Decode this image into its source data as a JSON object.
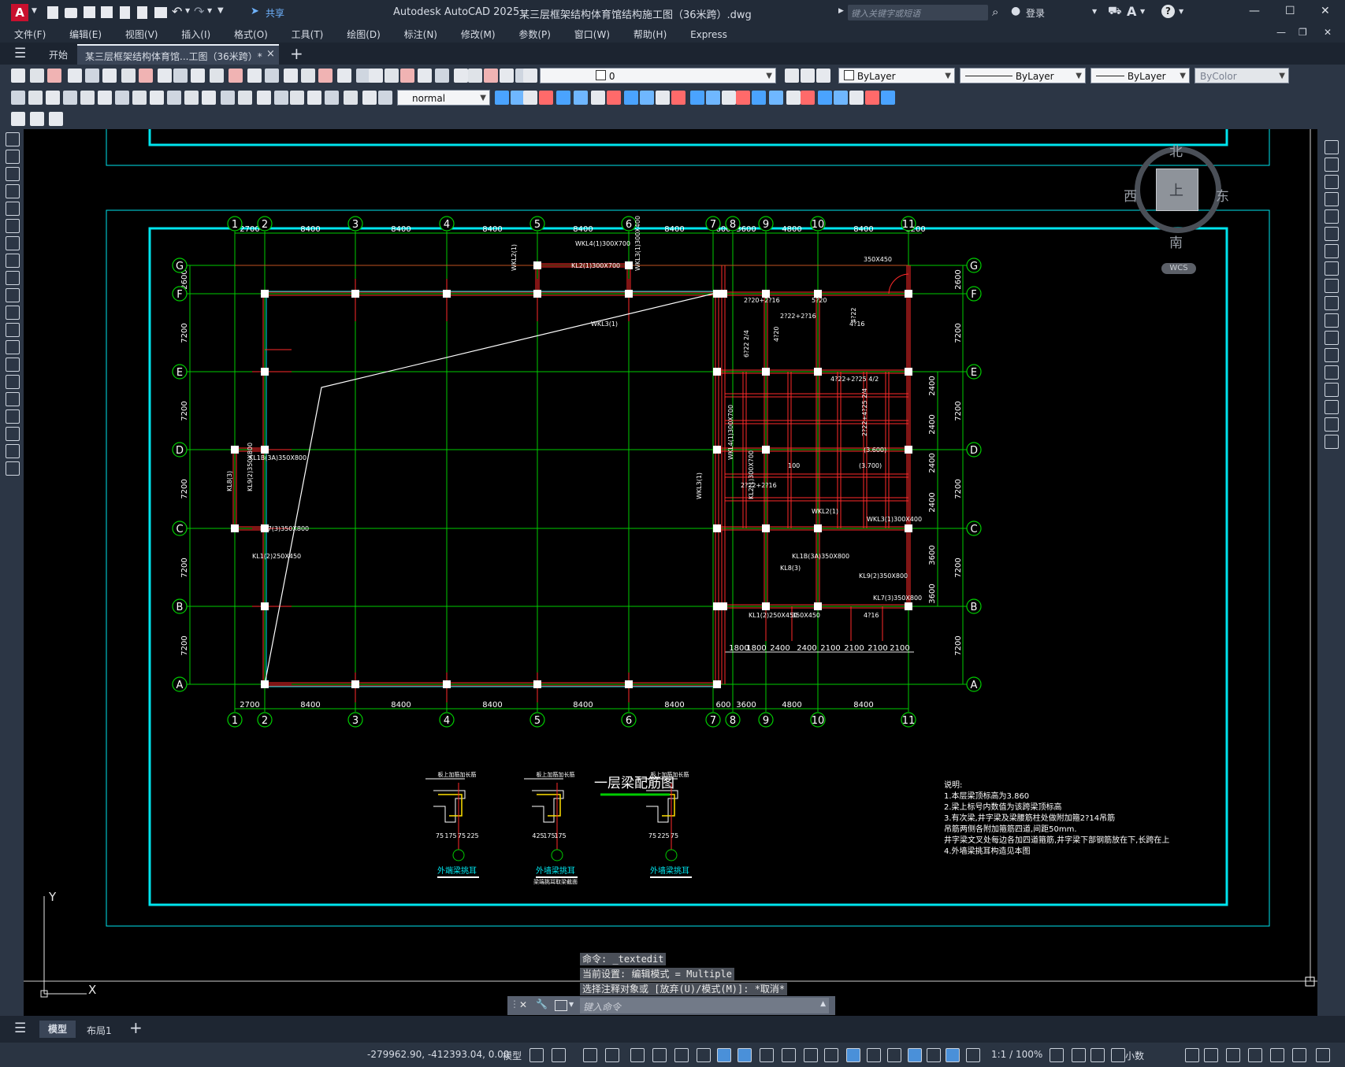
{
  "app": {
    "title": "Autodesk AutoCAD 2025",
    "doc_title": "某三层框架结构体育馆结构施工图（36米跨）.dwg",
    "search_placeholder": "键入关键字或短语",
    "login": "登录",
    "share": "共享",
    "logo": "A"
  },
  "menu": [
    "文件(F)",
    "编辑(E)",
    "视图(V)",
    "插入(I)",
    "格式(O)",
    "工具(T)",
    "绘图(D)",
    "标注(N)",
    "修改(M)",
    "参数(P)",
    "窗口(W)",
    "帮助(H)",
    "Express"
  ],
  "tabs": {
    "start": "开始",
    "doc": "某三层框架结构体育馆...工图（36米跨）*",
    "close": "×",
    "add": "+"
  },
  "toolbar": {
    "layer_value": "0",
    "color": "ByLayer",
    "linetype": "ByLayer",
    "lineweight": "ByLayer",
    "plotstyle": "ByColor",
    "dimstyle": "normal"
  },
  "viewcube": {
    "north": "北",
    "south": "南",
    "east": "东",
    "west": "西",
    "top": "上",
    "wcs": "WCS"
  },
  "drawing": {
    "title": "一层梁配筋图",
    "top_dims": [
      "2700",
      "8400",
      "8400",
      "8400",
      "8400",
      "8400",
      "600",
      "3600",
      "4800",
      "8400",
      "1200"
    ],
    "bottom_dims": [
      "2700",
      "8400",
      "8400",
      "8400",
      "8400",
      "8400",
      "600",
      "3600",
      "4800",
      "8400"
    ],
    "left_dims": [
      "2600",
      "7200",
      "7200",
      "7200",
      "7200",
      "7200"
    ],
    "right_dims_inner": [
      "2400",
      "2400",
      "2400",
      "2400",
      "3600",
      "3600"
    ],
    "right_dims": [
      "2600",
      "7200",
      "7200",
      "7200",
      "7200",
      "7200"
    ],
    "bottom_right_dims": [
      "1800",
      "1800",
      "2400",
      "2400",
      "2100",
      "2100",
      "2100",
      "2100"
    ],
    "axes_x": [
      "1",
      "2",
      "3",
      "4",
      "5",
      "6",
      "7",
      "8",
      "9",
      "10",
      "11"
    ],
    "axes_y": [
      "G",
      "F",
      "E",
      "D",
      "C",
      "B",
      "A"
    ],
    "beam_labels": [
      "WKL4(1)300X700",
      "KL2(1)300X700",
      "WKL3(1)",
      "WKL2(1)",
      "WKL3(1)300X400",
      "KL1B(3A)350X800",
      "KL8(3)",
      "KL9(2)350X800",
      "KL7(3)350X800",
      "KL1(2)250X450",
      "350X450",
      "4?16",
      "2?22+2?16",
      "2?20+2?16",
      "5?20",
      "4?22",
      "4?20",
      "6?22 2/4",
      "4?22+2?25 4/2",
      "2?22+4?25 2/4",
      "(3.600)",
      "(3.700)",
      "100"
    ],
    "details": [
      {
        "title": "外端梁挑耳",
        "note": "板上加筋加长筋",
        "dims": [
          "75",
          "175",
          "75",
          "225"
        ]
      },
      {
        "title": "外墙梁挑耳",
        "note": "板上加筋加长筋",
        "sub": "梁端挑耳取梁截面",
        "dims": [
          "425",
          "175",
          "175"
        ]
      },
      {
        "title": "外墙梁挑耳",
        "note": "板上加筋加长筋",
        "dims": [
          "75",
          "225",
          "75"
        ]
      }
    ],
    "notes": [
      "说明:",
      "1.本层梁顶标高为3.860",
      "2.梁上标号内数值为该跨梁顶标高",
      "3.有次梁,井字梁及梁腰筋柱处做附加箍2?14吊筋",
      "  吊筋两侧各附加箍筋四道,间距50mm.",
      "  井字梁文叉处每边各加四道箍筋,井字梁下部钢筋放在下,长跨在上",
      "4.外墙梁挑耳构造见本图"
    ]
  },
  "command": {
    "line1": "命令:  _textedit",
    "line2": "当前设置: 编辑模式 = Multiple",
    "line3": "选择注释对象或 [放弃(U)/模式(M)]: *取消*",
    "placeholder": "键入命令"
  },
  "layout_tabs": {
    "model": "模型",
    "layout1": "布局1",
    "add": "+"
  },
  "status": {
    "coords": "-279962.90, -412393.04, 0.00",
    "mode": "模型",
    "scale": "1:1 / 100%",
    "units": "小数"
  },
  "colors": {
    "frame": "#00e5ee",
    "grid": "#00cc00",
    "beam": "#ff2a2a",
    "text": "#ffffff",
    "background": "#000000"
  }
}
